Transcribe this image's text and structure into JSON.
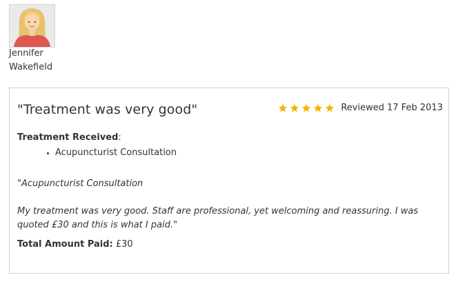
{
  "reviewer": {
    "avatar_icon": "female-avatar-icon",
    "name_line1": "Jennifer",
    "name_line2": "Wakefield"
  },
  "review": {
    "title": "\"Treatment was very good\"",
    "rating": 5,
    "max_rating": 5,
    "star_color": "#f5b400",
    "reviewed_label": "Reviewed 17 Feb 2013",
    "treatment_label": "Treatment Received",
    "treatment_colon": ":",
    "treatments": [
      "Acupuncturist Consultation"
    ],
    "quote_line1": "\"Acupuncturist Consultation",
    "quote_body": "My treatment was very good. Staff are professional, yet welcoming and reassuring. I was quoted £30 and this is what I paid.\"",
    "paid_label": "Total Amount Paid:",
    "paid_value": " £30"
  },
  "colors": {
    "border": "#cfcfcf",
    "text": "#333333"
  }
}
